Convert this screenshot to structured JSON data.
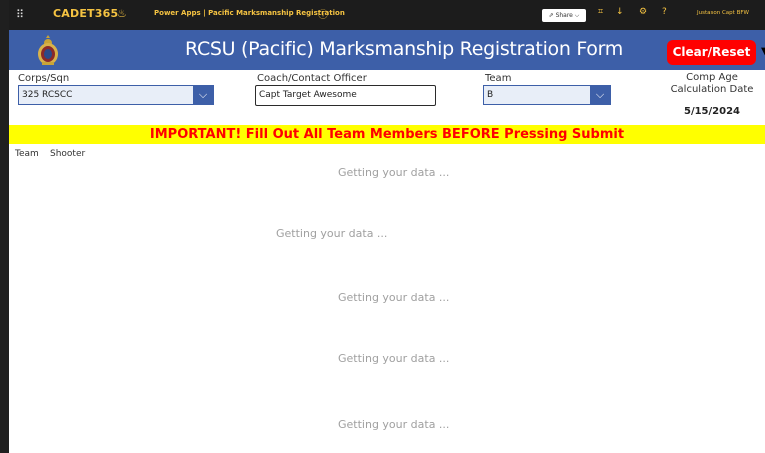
{
  "topbar": {
    "app_name": "CADET365",
    "breadcrumb": "Power Apps  |  Pacific Marksmanship Registration",
    "share_label": "Share",
    "user": "Justason Capt BFW",
    "icons": [
      "waffle-icon",
      "info-icon",
      "share-icon",
      "fit-icon",
      "download-icon",
      "settings-icon",
      "help-icon"
    ]
  },
  "header": {
    "title": "RCSU (Pacific) Marksmanship Registration Form",
    "clear_label": "Clear/Reset",
    "color": "#3d5fa8"
  },
  "fields": {
    "corps_label": "Corps/Sqn",
    "corps_value": "325 RCSCC",
    "coach_label": "Coach/Contact Officer",
    "coach_value": "Capt Target Awesome",
    "team_label": "Team",
    "team_value": "B",
    "age_label": "Comp Age Calculation Date",
    "age_value": "5/15/2024"
  },
  "banner": {
    "text": "IMPORTANT! Fill Out All Team Members BEFORE Pressing Submit",
    "bg": "#ffff00",
    "color": "#ff0000"
  },
  "list": {
    "col_team": "Team",
    "col_shooter": "Shooter",
    "loading_1": "Getting your data ...",
    "loading_2": "Getting your data ...",
    "loading_3": "Getting your data ...",
    "loading_4": "Getting your data ...",
    "loading_5": "Getting your data ..."
  }
}
